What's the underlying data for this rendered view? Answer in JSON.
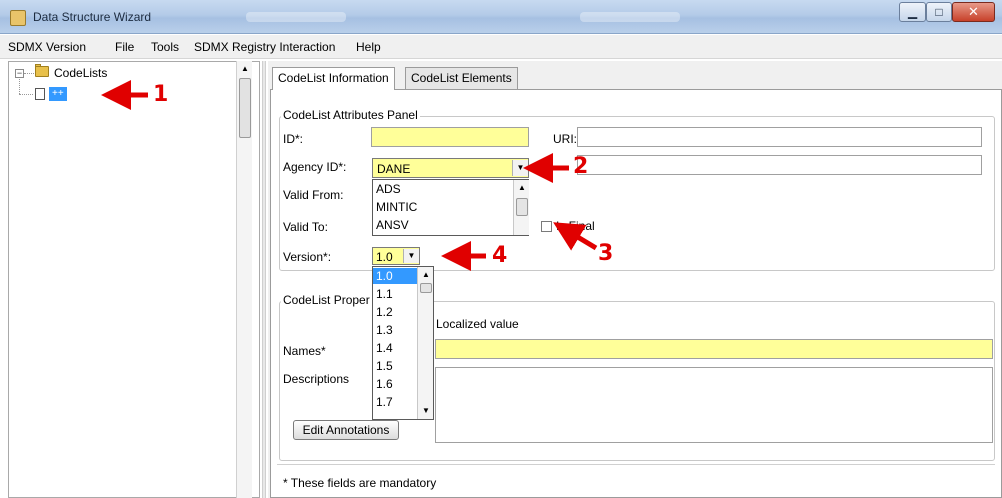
{
  "window": {
    "title": "Data Structure Wizard"
  },
  "menu": {
    "items": [
      "SDMX Version",
      "File",
      "Tools",
      "SDMX Registry Interaction",
      "Help"
    ]
  },
  "tree": {
    "root_label": "CodeLists",
    "toggle": "−",
    "node_label": "++"
  },
  "tabs": {
    "info": "CodeList Information",
    "elements": "CodeList Elements"
  },
  "attributes": {
    "title": "CodeList Attributes Panel",
    "id_label": "ID*:",
    "uri_label": "URI:",
    "agency_label": "Agency ID*:",
    "agency_value": "DANE",
    "agency_options": [
      "ADS",
      "MINTIC",
      "ANSV"
    ],
    "valid_from_label": "Valid From:",
    "valid_to_label": "Valid To:",
    "is_final_label": "Is Final",
    "version_label": "Version*:",
    "version_value": "1.0",
    "version_options": [
      "1.0",
      "1.1",
      "1.2",
      "1.3",
      "1.4",
      "1.5",
      "1.6",
      "1.7"
    ]
  },
  "properties": {
    "title": "CodeList Proper",
    "col_partial": "L",
    "localized_value": "Localized value",
    "names_label": "Names*",
    "descriptions_label": "Descriptions",
    "edit_annotations": "Edit Annotations"
  },
  "footer": {
    "mandatory_note": "* These fields are mandatory"
  },
  "annotations": {
    "a1": "1",
    "a2": "2",
    "a3": "3",
    "a4": "4"
  },
  "colors": {
    "annotation": "#e00000",
    "required_field": "#ffff99",
    "selection": "#3399ff"
  }
}
